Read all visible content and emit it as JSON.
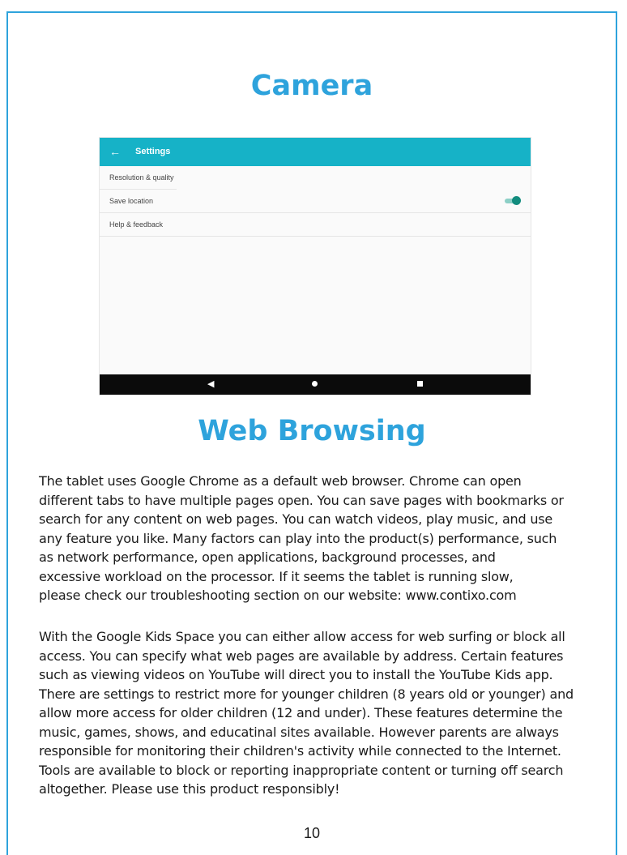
{
  "headings": {
    "camera": "Camera",
    "web_browsing": "Web Browsing"
  },
  "screenshot": {
    "header_title": "Settings",
    "back_icon": "back-arrow-icon",
    "rows": [
      {
        "label": "Resolution & quality"
      },
      {
        "label": "Save location",
        "toggle_on": true
      },
      {
        "label": "Help & feedback"
      }
    ],
    "accent_color": "#16b2c7",
    "nav_icons": [
      "nav-back-icon",
      "nav-home-icon",
      "nav-recent-icon"
    ]
  },
  "body": {
    "paragraph1_lines": [
      "The tablet uses Google Chrome as a default web browser. Chrome can open",
      "different tabs to have multiple pages open.  You can save pages with bookmarks or",
      "search for any content on web pages. You can watch videos, play music, and use",
      "any feature you like. Many factors can play into the product(s) performance, such",
      "as network performance, open applications, background processes, and",
      "excessive workload on the processor. If it seems the tablet is running slow,",
      "please check our troubleshooting section on our website: www.contixo.com"
    ],
    "paragraph2_lines": [
      "With the Google Kids Space you can either allow access for web surfing or block all",
      "access. You can specify what web pages are available by address. Certain features",
      "such as viewing videos on YouTube will direct you to install the YouTube Kids app.",
      "There are settings to restrict more for younger children (8 years old or younger) and",
      "allow more access for older children (12 and under). These features determine the",
      "music, games, shows, and educatinal sites available. However parents are always",
      "responsible for monitoring their children's activity while connected to the Internet.",
      "Tools are available to block or reporting inappropriate content or turning off search",
      "altogether. Please use this product responsibly!"
    ]
  },
  "page_number": "10",
  "colors": {
    "heading": "#2ea3dc",
    "border": "#2ea3dc"
  }
}
